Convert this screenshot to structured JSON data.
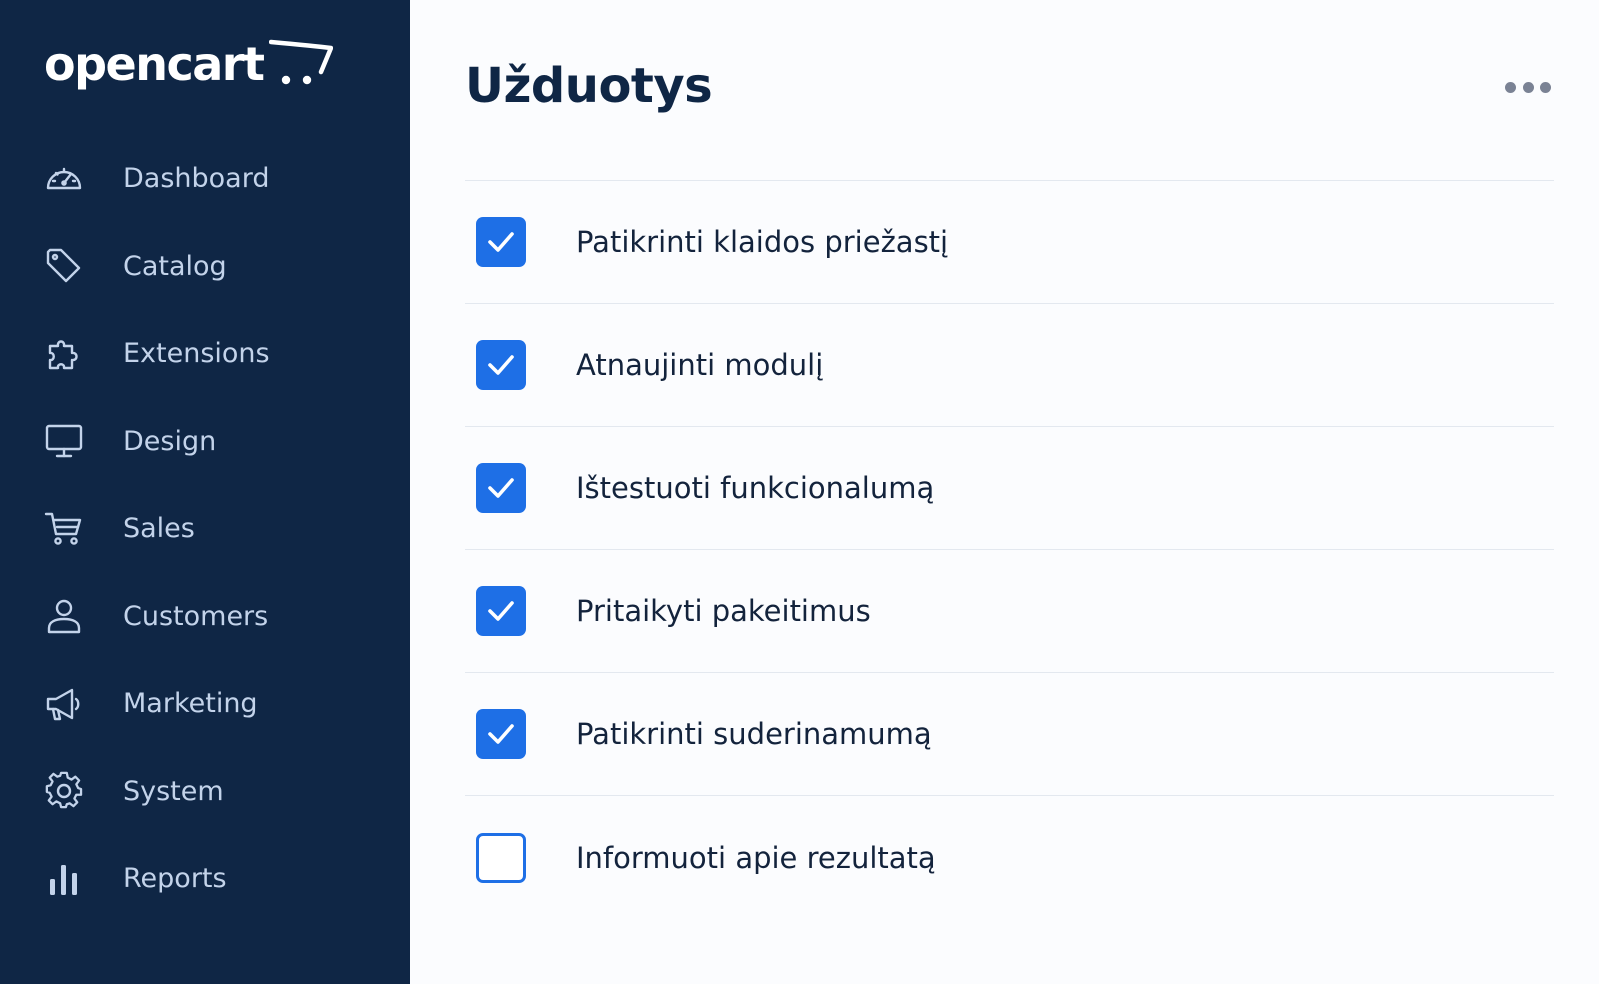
{
  "brand": {
    "name": "opencart",
    "icon": "cart-logo-icon"
  },
  "sidebar": {
    "items": [
      {
        "label": "Dashboard",
        "icon": "dashboard-gauge-icon"
      },
      {
        "label": "Catalog",
        "icon": "tag-icon"
      },
      {
        "label": "Extensions",
        "icon": "puzzle-icon"
      },
      {
        "label": "Design",
        "icon": "monitor-icon"
      },
      {
        "label": "Sales",
        "icon": "cart-icon"
      },
      {
        "label": "Customers",
        "icon": "user-icon"
      },
      {
        "label": "Marketing",
        "icon": "megaphone-icon"
      },
      {
        "label": "System",
        "icon": "gear-icon"
      },
      {
        "label": "Reports",
        "icon": "bar-chart-icon"
      }
    ]
  },
  "main": {
    "title": "Užduotys",
    "menu_icon": "more-horizontal-icon",
    "tasks": [
      {
        "label": "Patikrinti klaidos priežastį",
        "checked": true
      },
      {
        "label": "Atnaujinti modulį",
        "checked": true
      },
      {
        "label": "Ištestuoti funkcionalumą",
        "checked": true
      },
      {
        "label": "Pritaikyti pakeitimus",
        "checked": true
      },
      {
        "label": "Patikrinti suderinamumą",
        "checked": true
      },
      {
        "label": "Informuoti apie rezultatą",
        "checked": false
      }
    ]
  },
  "colors": {
    "sidebar_bg": "#0f2645",
    "sidebar_text": "#c3d3ea",
    "accent": "#1e6fe6",
    "title": "#0f2645",
    "divider": "#e3e8ef"
  }
}
